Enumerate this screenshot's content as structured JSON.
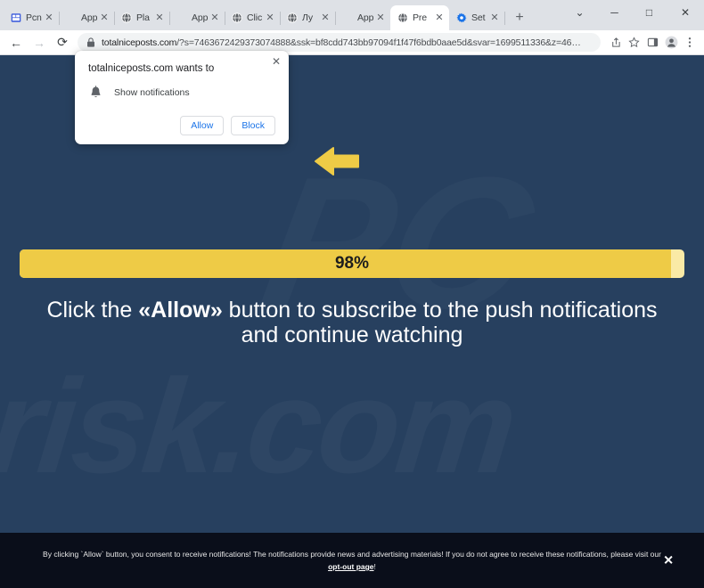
{
  "browser": {
    "tabs": [
      {
        "title": "Pcn",
        "favicon": "window-icon",
        "active": false
      },
      {
        "title": "App",
        "favicon": "blank-icon",
        "active": false
      },
      {
        "title": "Pla",
        "favicon": "globe-icon",
        "active": false
      },
      {
        "title": "App",
        "favicon": "blank-icon",
        "active": false
      },
      {
        "title": "Clic",
        "favicon": "globe-icon",
        "active": false
      },
      {
        "title": "Лу",
        "favicon": "globe-icon",
        "active": false
      },
      {
        "title": "App",
        "favicon": "blank-icon",
        "active": false
      },
      {
        "title": "Pre",
        "favicon": "globe-icon",
        "active": true
      },
      {
        "title": "Set",
        "favicon": "gear-icon",
        "active": false
      }
    ],
    "new_tab_label": "+",
    "window_controls": {
      "tab_search": "⌄",
      "minimize": "─",
      "maximize": "□",
      "close": "✕"
    },
    "nav": {
      "back": "←",
      "forward": "→",
      "reload": "⟳"
    },
    "address": {
      "host": "totalniceposts.com",
      "path": "/?s=7463672429373074888&ssk=bf8cdd743bb97094f1f47f6bdb0aae5d&svar=1699511336&z=46…",
      "lock": "lock-icon"
    },
    "toolbar_icons": [
      "share-icon",
      "bookmark-star-icon",
      "side-panel-icon",
      "profile-icon",
      "menu-icon"
    ]
  },
  "permission_dialog": {
    "title": "totalniceposts.com wants to",
    "permission_label": "Show notifications",
    "icon": "bell-icon",
    "close_label": "✕",
    "allow_label": "Allow",
    "block_label": "Block",
    "button_color": "#1a73e8"
  },
  "page": {
    "watermark_text": "risk.com",
    "watermark_text_2": "PC",
    "arrow": "left-arrow-icon",
    "progress": {
      "percent": 98,
      "label": "98%",
      "fill_color": "#eecb46",
      "track_color": "#faeaa6"
    },
    "headline": {
      "part1": "Click the ",
      "emphasis": "«Allow»",
      "part2": " button to subscribe to the push notifications and continue watching"
    },
    "background_color": "#27405f"
  },
  "consent_bar": {
    "text_part1": "By clicking `Allow` button, you consent to receive notifications! The notifications provide news and advertising materials! If you do not agree to receive these notifications, please visit our ",
    "link_text": "opt-out page",
    "text_part2": "!",
    "close_label": "✕",
    "background_color": "#0a0e1a"
  }
}
